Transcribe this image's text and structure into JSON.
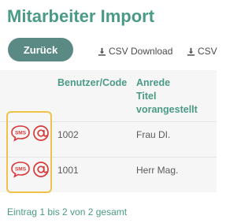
{
  "page": {
    "title": "Mitarbeiter Import"
  },
  "toolbar": {
    "back_label": "Zurück",
    "csv_download_label": "CSV Download",
    "csv_second_label": "CSV"
  },
  "table": {
    "headers": {
      "user_code": "Benutzer/Code",
      "salutation": "Anrede",
      "title_prefix_line1": "Titel",
      "title_prefix_line2": "vorangestellt"
    },
    "rows": [
      {
        "code": "1002",
        "salutation_title": "Frau DI."
      },
      {
        "code": "1001",
        "salutation_title": "Herr Mag."
      }
    ]
  },
  "icons": {
    "sms": "sms-icon",
    "email": "at-sign-icon",
    "download": "download-icon",
    "sms_text": "SMS"
  },
  "footer": {
    "pagination_text": "Eintrag 1 bis 2 von 2 gesamt"
  },
  "colors": {
    "accent": "#4a9a86",
    "button": "#5b8a84",
    "icon_red": "#d83a3a",
    "highlight": "#f0c24b"
  }
}
